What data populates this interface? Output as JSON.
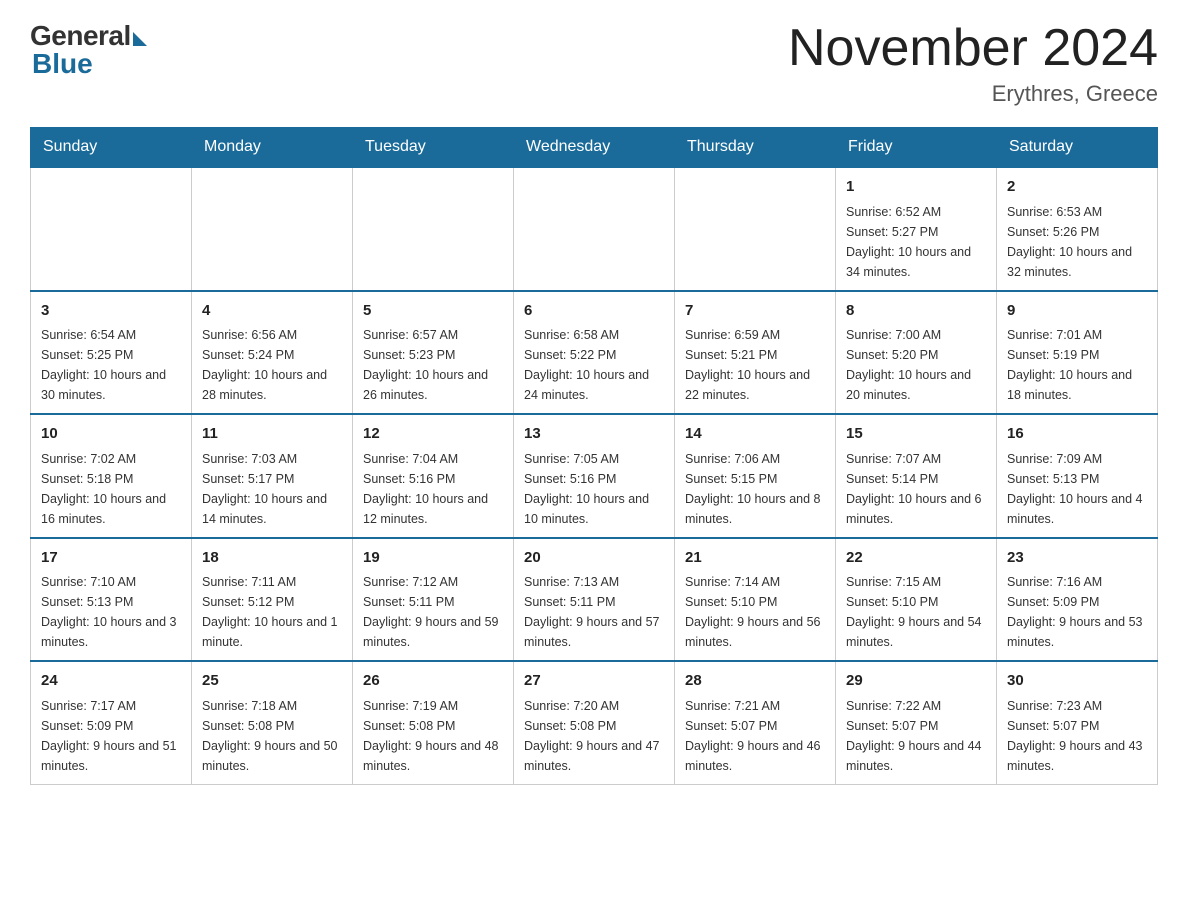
{
  "logo": {
    "general": "General",
    "blue": "Blue"
  },
  "title": "November 2024",
  "location": "Erythres, Greece",
  "days_of_week": [
    "Sunday",
    "Monday",
    "Tuesday",
    "Wednesday",
    "Thursday",
    "Friday",
    "Saturday"
  ],
  "weeks": [
    [
      {
        "day": "",
        "info": ""
      },
      {
        "day": "",
        "info": ""
      },
      {
        "day": "",
        "info": ""
      },
      {
        "day": "",
        "info": ""
      },
      {
        "day": "",
        "info": ""
      },
      {
        "day": "1",
        "info": "Sunrise: 6:52 AM\nSunset: 5:27 PM\nDaylight: 10 hours and 34 minutes."
      },
      {
        "day": "2",
        "info": "Sunrise: 6:53 AM\nSunset: 5:26 PM\nDaylight: 10 hours and 32 minutes."
      }
    ],
    [
      {
        "day": "3",
        "info": "Sunrise: 6:54 AM\nSunset: 5:25 PM\nDaylight: 10 hours and 30 minutes."
      },
      {
        "day": "4",
        "info": "Sunrise: 6:56 AM\nSunset: 5:24 PM\nDaylight: 10 hours and 28 minutes."
      },
      {
        "day": "5",
        "info": "Sunrise: 6:57 AM\nSunset: 5:23 PM\nDaylight: 10 hours and 26 minutes."
      },
      {
        "day": "6",
        "info": "Sunrise: 6:58 AM\nSunset: 5:22 PM\nDaylight: 10 hours and 24 minutes."
      },
      {
        "day": "7",
        "info": "Sunrise: 6:59 AM\nSunset: 5:21 PM\nDaylight: 10 hours and 22 minutes."
      },
      {
        "day": "8",
        "info": "Sunrise: 7:00 AM\nSunset: 5:20 PM\nDaylight: 10 hours and 20 minutes."
      },
      {
        "day": "9",
        "info": "Sunrise: 7:01 AM\nSunset: 5:19 PM\nDaylight: 10 hours and 18 minutes."
      }
    ],
    [
      {
        "day": "10",
        "info": "Sunrise: 7:02 AM\nSunset: 5:18 PM\nDaylight: 10 hours and 16 minutes."
      },
      {
        "day": "11",
        "info": "Sunrise: 7:03 AM\nSunset: 5:17 PM\nDaylight: 10 hours and 14 minutes."
      },
      {
        "day": "12",
        "info": "Sunrise: 7:04 AM\nSunset: 5:16 PM\nDaylight: 10 hours and 12 minutes."
      },
      {
        "day": "13",
        "info": "Sunrise: 7:05 AM\nSunset: 5:16 PM\nDaylight: 10 hours and 10 minutes."
      },
      {
        "day": "14",
        "info": "Sunrise: 7:06 AM\nSunset: 5:15 PM\nDaylight: 10 hours and 8 minutes."
      },
      {
        "day": "15",
        "info": "Sunrise: 7:07 AM\nSunset: 5:14 PM\nDaylight: 10 hours and 6 minutes."
      },
      {
        "day": "16",
        "info": "Sunrise: 7:09 AM\nSunset: 5:13 PM\nDaylight: 10 hours and 4 minutes."
      }
    ],
    [
      {
        "day": "17",
        "info": "Sunrise: 7:10 AM\nSunset: 5:13 PM\nDaylight: 10 hours and 3 minutes."
      },
      {
        "day": "18",
        "info": "Sunrise: 7:11 AM\nSunset: 5:12 PM\nDaylight: 10 hours and 1 minute."
      },
      {
        "day": "19",
        "info": "Sunrise: 7:12 AM\nSunset: 5:11 PM\nDaylight: 9 hours and 59 minutes."
      },
      {
        "day": "20",
        "info": "Sunrise: 7:13 AM\nSunset: 5:11 PM\nDaylight: 9 hours and 57 minutes."
      },
      {
        "day": "21",
        "info": "Sunrise: 7:14 AM\nSunset: 5:10 PM\nDaylight: 9 hours and 56 minutes."
      },
      {
        "day": "22",
        "info": "Sunrise: 7:15 AM\nSunset: 5:10 PM\nDaylight: 9 hours and 54 minutes."
      },
      {
        "day": "23",
        "info": "Sunrise: 7:16 AM\nSunset: 5:09 PM\nDaylight: 9 hours and 53 minutes."
      }
    ],
    [
      {
        "day": "24",
        "info": "Sunrise: 7:17 AM\nSunset: 5:09 PM\nDaylight: 9 hours and 51 minutes."
      },
      {
        "day": "25",
        "info": "Sunrise: 7:18 AM\nSunset: 5:08 PM\nDaylight: 9 hours and 50 minutes."
      },
      {
        "day": "26",
        "info": "Sunrise: 7:19 AM\nSunset: 5:08 PM\nDaylight: 9 hours and 48 minutes."
      },
      {
        "day": "27",
        "info": "Sunrise: 7:20 AM\nSunset: 5:08 PM\nDaylight: 9 hours and 47 minutes."
      },
      {
        "day": "28",
        "info": "Sunrise: 7:21 AM\nSunset: 5:07 PM\nDaylight: 9 hours and 46 minutes."
      },
      {
        "day": "29",
        "info": "Sunrise: 7:22 AM\nSunset: 5:07 PM\nDaylight: 9 hours and 44 minutes."
      },
      {
        "day": "30",
        "info": "Sunrise: 7:23 AM\nSunset: 5:07 PM\nDaylight: 9 hours and 43 minutes."
      }
    ]
  ]
}
